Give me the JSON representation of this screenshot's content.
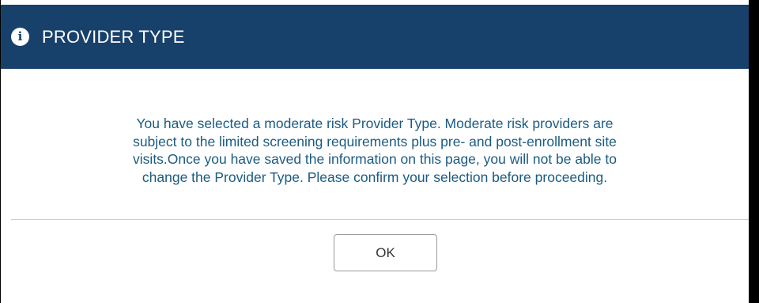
{
  "dialog": {
    "title": "PROVIDER TYPE",
    "icon": "info-icon",
    "icon_glyph": "i",
    "message_lines": [
      "You have selected a moderate risk Provider Type. Moderate risk providers are",
      "subject to the limited screening requirements plus pre- and post-enrollment site",
      "visits.Once you have saved the information on this page, you will not be able to",
      "change the Provider Type. Please confirm your selection before proceeding."
    ],
    "ok_label": "OK"
  },
  "colors": {
    "titlebar_bg": "#17416a",
    "title_text": "#ffffff",
    "message_text": "#1b5b82",
    "divider": "#cfcfcf",
    "button_border": "#9a9a9a"
  }
}
